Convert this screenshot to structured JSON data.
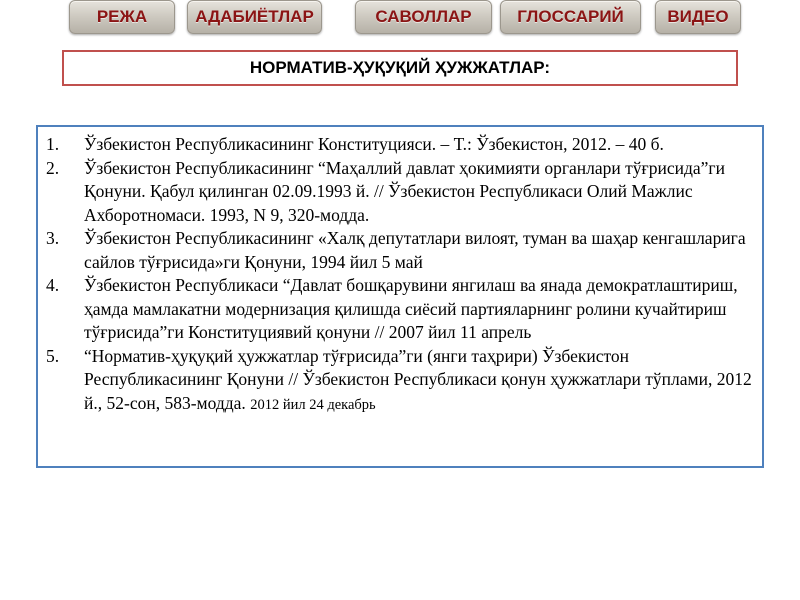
{
  "nav": {
    "buttons": [
      "РЕЖА",
      "АДАБИЁТЛАР",
      "САВОЛЛАР",
      "ГЛОССАРИЙ",
      "ВИДЕО"
    ]
  },
  "title": "НОРМАТИВ-ҲУҚУҚИЙ ҲУЖЖАТЛАР:",
  "list": {
    "items": [
      {
        "num": "1.",
        "text": "Ўзбекистон Республикасининг Конституцияси. – Т.: Ўзбекистон, 2012. – 40 б."
      },
      {
        "num": "2.",
        "text": "Ўзбекистон Республикасининг “Маҳаллий давлат ҳокимияти органлари тўғрисида”ги Қонуни. Қабул қилинган 02.09.1993 й. // Ўзбекистон Республикаси Олий Мажлис Ахборотномаси. 1993, N 9,  320-модда."
      },
      {
        "num": "3.",
        "text": "Ўзбекистон Республикасининг «Халқ депутатлари вилоят, туман ва шаҳар кенгашларига сайлов тўғрисида»ги Қонуни, 1994 йил 5 май"
      },
      {
        "num": "4.",
        "text": "Ўзбекистон Республикаси “Давлат бошқарувини янгилаш ва янада демократлаштириш, ҳамда мамлакатни модернизация қилишда сиёсий партияларнинг ролини кучайтириш тўғрисида”ги Конституциявий қонуни // 2007 йил 11 апрель"
      },
      {
        "num": "5.",
        "text": "“Норматив-ҳуқуқий ҳужжатлар тўғрисида”ги (янги таҳрири) Ўзбекистон Республикасининг Қонуни // Ўзбекистон Республикаси қонун ҳужжатлари тўплами, 2012 й., 52-сон, 583-модда.",
        "date": "2012 йил 24 декабрь"
      }
    ]
  }
}
